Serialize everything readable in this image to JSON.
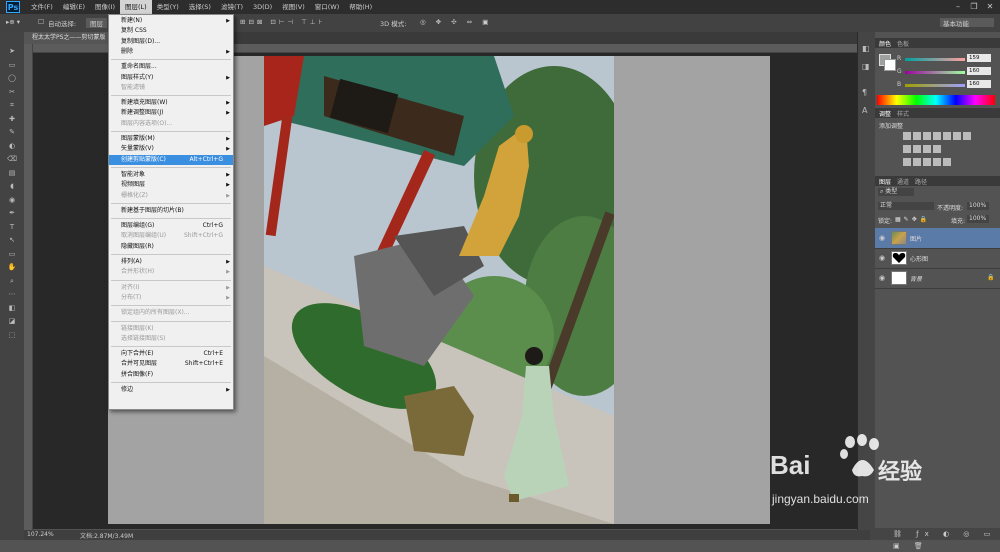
{
  "app": {
    "logo": "Ps"
  },
  "menubar": [
    "文件(F)",
    "编辑(E)",
    "图像(I)",
    "图层(L)",
    "类型(Y)",
    "选择(S)",
    "滤镜(T)",
    "3D(D)",
    "视图(V)",
    "窗口(W)",
    "帮助(H)"
  ],
  "options": {
    "auto_select": "自动选择:",
    "group": "图层",
    "mode3d": "3D 模式:",
    "workspace": "基本功能"
  },
  "document": {
    "tab_title": "程太太学PS之——剪切蒙版"
  },
  "layer_menu": [
    {
      "label": "新建(N)",
      "arrow": true
    },
    {
      "label": "复制 CSS"
    },
    {
      "label": "复制图层(D)..."
    },
    {
      "label": "删除",
      "arrow": true
    },
    {
      "sep": true
    },
    {
      "label": "重命名图层..."
    },
    {
      "label": "图层样式(Y)",
      "arrow": true
    },
    {
      "label": "智能滤镜",
      "disabled": true
    },
    {
      "sep": true
    },
    {
      "label": "新建填充图层(W)",
      "arrow": true
    },
    {
      "label": "新建调整图层(J)",
      "arrow": true
    },
    {
      "label": "图层内容选项(O)...",
      "disabled": true
    },
    {
      "sep": true
    },
    {
      "label": "图层蒙版(M)",
      "arrow": true
    },
    {
      "label": "矢量蒙版(V)",
      "arrow": true
    },
    {
      "label": "创建剪贴蒙版(C)",
      "shortcut": "Alt+Ctrl+G",
      "highlight": true
    },
    {
      "sep": true
    },
    {
      "label": "智能对象",
      "arrow": true
    },
    {
      "label": "视频图层",
      "arrow": true
    },
    {
      "label": "栅格化(Z)",
      "arrow": true,
      "disabled": true
    },
    {
      "sep": true
    },
    {
      "label": "新建基于图层的切片(B)"
    },
    {
      "sep": true
    },
    {
      "label": "图层编组(G)",
      "shortcut": "Ctrl+G"
    },
    {
      "label": "取消图层编组(U)",
      "shortcut": "Shift+Ctrl+G",
      "disabled": true
    },
    {
      "label": "隐藏图层(R)"
    },
    {
      "sep": true
    },
    {
      "label": "排列(A)",
      "arrow": true
    },
    {
      "label": "合并形状(H)",
      "arrow": true,
      "disabled": true
    },
    {
      "sep": true
    },
    {
      "label": "对齐(I)",
      "arrow": true,
      "disabled": true
    },
    {
      "label": "分布(T)",
      "arrow": true,
      "disabled": true
    },
    {
      "sep": true
    },
    {
      "label": "锁定组内的所有图层(X)...",
      "disabled": true
    },
    {
      "sep": true
    },
    {
      "label": "链接图层(K)",
      "disabled": true
    },
    {
      "label": "选择链接图层(S)",
      "disabled": true
    },
    {
      "sep": true
    },
    {
      "label": "向下合并(E)",
      "shortcut": "Ctrl+E"
    },
    {
      "label": "合并可见图层",
      "shortcut": "Shift+Ctrl+E"
    },
    {
      "label": "拼合图像(F)"
    },
    {
      "sep": true
    },
    {
      "label": "修边",
      "arrow": true
    }
  ],
  "color_panel": {
    "tabs": [
      "颜色",
      "色板"
    ],
    "r": "159",
    "g": "160",
    "b": "160"
  },
  "adjust_panel": {
    "tabs": [
      "调整",
      "样式"
    ],
    "title": "添加调整"
  },
  "layers_panel": {
    "tabs": [
      "图层",
      "通道",
      "路径"
    ],
    "kind": "类型",
    "blend": "正常",
    "opacity_label": "不透明度:",
    "opacity": "100%",
    "lock_label": "锁定:",
    "fill_label": "填充:",
    "fill": "100%",
    "layers": [
      {
        "name": "图片",
        "selected": true
      },
      {
        "name": "心形图",
        "selected": false
      },
      {
        "name": "背景",
        "selected": false
      }
    ]
  },
  "status": {
    "zoom": "107.24%",
    "doc": "文档:2.87M/3.49M"
  },
  "watermark": {
    "brand": "Bai",
    "brand2": "经验",
    "url": "jingyan.baidu.com"
  },
  "colors": {
    "highlight": "#3b8fe0",
    "menu_bg": "#f0f0f0",
    "selected_layer": "#5a7aa8"
  }
}
